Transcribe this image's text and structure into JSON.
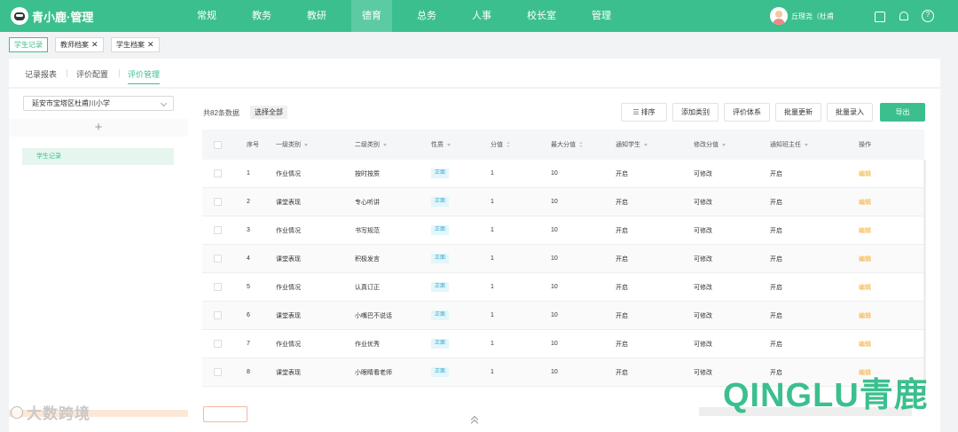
{
  "app": {
    "brand": "青小鹿·管理"
  },
  "topnav": {
    "items": [
      "常规",
      "教务",
      "教研",
      "德育",
      "总务",
      "人事",
      "校长室",
      "管理"
    ],
    "active_index": 3,
    "user_name": "丘理尧（杜甫",
    "icons": [
      "shirt-icon",
      "bell-icon",
      "help-icon"
    ]
  },
  "tabs": [
    {
      "label": "学生记录",
      "active": true,
      "closable": false
    },
    {
      "label": "教师档案",
      "active": false,
      "closable": true
    },
    {
      "label": "学生档案",
      "active": false,
      "closable": true
    }
  ],
  "tab_close_glyph": "✕",
  "subnav": {
    "items": [
      "记录报表",
      "评价配置",
      "评价管理"
    ],
    "active_index": 2
  },
  "sidebar": {
    "school_select": "延安市宝塔区杜甫川小学",
    "add_glyph": "+",
    "tree_items": [
      "学生记录"
    ]
  },
  "main": {
    "count_text": "共82条数据",
    "select_all": "选择全部",
    "buttons": {
      "sort": "排序",
      "add_category": "添加类别",
      "eval_system": "评价体系",
      "batch_update": "批量更新",
      "batch_entry": "批量录入",
      "export": "导出"
    },
    "columns": [
      "序号",
      "一级类别",
      "二级类别",
      "性质",
      "分值",
      "最大分值",
      "通知学生",
      "修改分值",
      "通知班主任",
      "操作"
    ],
    "rows": [
      [
        "1",
        "作业情况",
        "按时按质",
        "正面",
        "1",
        "10",
        "开启",
        "可修改",
        "开启",
        "编辑"
      ],
      [
        "2",
        "课堂表现",
        "专心听讲",
        "正面",
        "1",
        "10",
        "开启",
        "可修改",
        "开启",
        "编辑"
      ],
      [
        "3",
        "作业情况",
        "书写规范",
        "正面",
        "1",
        "10",
        "开启",
        "可修改",
        "开启",
        "编辑"
      ],
      [
        "4",
        "课堂表现",
        "积极发言",
        "正面",
        "1",
        "10",
        "开启",
        "可修改",
        "开启",
        "编辑"
      ],
      [
        "5",
        "作业情况",
        "认真订正",
        "正面",
        "1",
        "10",
        "开启",
        "可修改",
        "开启",
        "编辑"
      ],
      [
        "6",
        "课堂表现",
        "小嘴巴不说话",
        "正面",
        "1",
        "10",
        "开启",
        "可修改",
        "开启",
        "编辑"
      ],
      [
        "7",
        "作业情况",
        "作业优秀",
        "正面",
        "1",
        "10",
        "开启",
        "可修改",
        "开启",
        "编辑"
      ],
      [
        "8",
        "课堂表现",
        "小眼睛看老师",
        "正面",
        "1",
        "10",
        "开启",
        "可修改",
        "开启",
        "编辑"
      ]
    ]
  },
  "watermarks": {
    "left": "大数跨境",
    "right": "QINGLU青鹿"
  },
  "colors": {
    "brand": "#3cbf8e",
    "edit": "#f5a623",
    "tag": "#3aa9c9"
  }
}
